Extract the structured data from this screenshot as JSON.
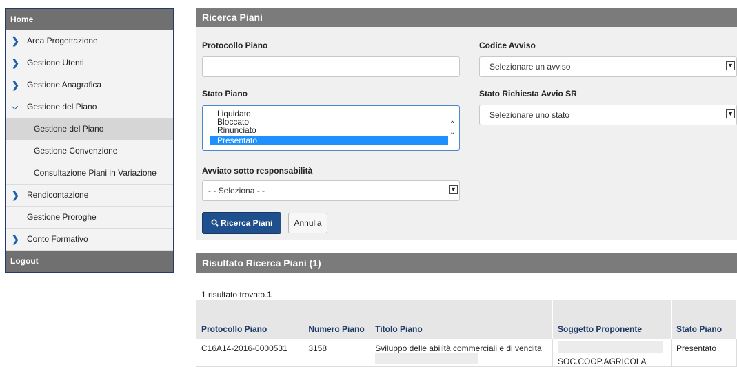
{
  "sidebar": {
    "home": "Home",
    "items": [
      {
        "label": "Area Progettazione"
      },
      {
        "label": "Gestione Utenti"
      },
      {
        "label": "Gestione Anagrafica"
      },
      {
        "label": "Gestione del Piano"
      },
      {
        "label": "Gestione del Piano"
      },
      {
        "label": "Gestione Convenzione"
      },
      {
        "label": "Consultazione Piani in Variazione"
      },
      {
        "label": "Rendicontazione"
      },
      {
        "label": "Gestione Proroghe"
      },
      {
        "label": "Conto Formativo"
      }
    ],
    "logout": "Logout"
  },
  "search": {
    "title": "Ricerca Piani",
    "protocollo_label": "Protocollo Piano",
    "protocollo_value": "",
    "codice_avviso_label": "Codice Avviso",
    "codice_avviso_selected": "Selezionare un avviso",
    "stato_piano_label": "Stato Piano",
    "stato_piano_options": [
      "Liquidato",
      "Bloccato",
      "Rinunciato",
      "Presentato"
    ],
    "stato_piano_selected": "Presentato",
    "stato_richiesta_label": "Stato Richiesta Avvio SR",
    "stato_richiesta_selected": "Selezionare uno stato",
    "avviato_label": "Avviato sotto responsabilità",
    "avviato_selected": "- - Seleziona - -",
    "search_button": "Ricerca Piani",
    "cancel_button": "Annulla"
  },
  "results": {
    "title": "Risultato Ricerca Piani  (1)",
    "count_text": "1 risultato trovato.",
    "count_value": "1",
    "columns": [
      "Protocollo Piano",
      "Numero Piano",
      "Titolo Piano",
      "Soggetto Proponente",
      "Stato Piano"
    ],
    "rows": [
      {
        "protocollo": "C16A14-2016-0000531",
        "numero": "3158",
        "titolo": "Sviluppo delle abilità commerciali e di vendita",
        "soggetto": "SOC.COOP.AGRICOLA",
        "stato": "Presentato"
      }
    ]
  }
}
